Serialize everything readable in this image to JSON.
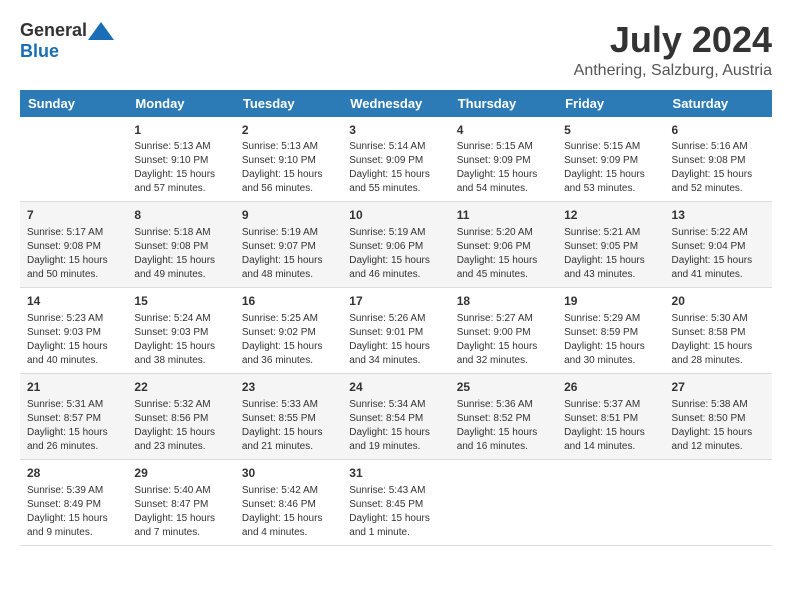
{
  "header": {
    "logo_general": "General",
    "logo_blue": "Blue",
    "title": "July 2024",
    "location": "Anthering, Salzburg, Austria"
  },
  "calendar": {
    "weekdays": [
      "Sunday",
      "Monday",
      "Tuesday",
      "Wednesday",
      "Thursday",
      "Friday",
      "Saturday"
    ],
    "weeks": [
      [
        {
          "day": "",
          "info": ""
        },
        {
          "day": "1",
          "info": "Sunrise: 5:13 AM\nSunset: 9:10 PM\nDaylight: 15 hours\nand 57 minutes."
        },
        {
          "day": "2",
          "info": "Sunrise: 5:13 AM\nSunset: 9:10 PM\nDaylight: 15 hours\nand 56 minutes."
        },
        {
          "day": "3",
          "info": "Sunrise: 5:14 AM\nSunset: 9:09 PM\nDaylight: 15 hours\nand 55 minutes."
        },
        {
          "day": "4",
          "info": "Sunrise: 5:15 AM\nSunset: 9:09 PM\nDaylight: 15 hours\nand 54 minutes."
        },
        {
          "day": "5",
          "info": "Sunrise: 5:15 AM\nSunset: 9:09 PM\nDaylight: 15 hours\nand 53 minutes."
        },
        {
          "day": "6",
          "info": "Sunrise: 5:16 AM\nSunset: 9:08 PM\nDaylight: 15 hours\nand 52 minutes."
        }
      ],
      [
        {
          "day": "7",
          "info": "Sunrise: 5:17 AM\nSunset: 9:08 PM\nDaylight: 15 hours\nand 50 minutes."
        },
        {
          "day": "8",
          "info": "Sunrise: 5:18 AM\nSunset: 9:08 PM\nDaylight: 15 hours\nand 49 minutes."
        },
        {
          "day": "9",
          "info": "Sunrise: 5:19 AM\nSunset: 9:07 PM\nDaylight: 15 hours\nand 48 minutes."
        },
        {
          "day": "10",
          "info": "Sunrise: 5:19 AM\nSunset: 9:06 PM\nDaylight: 15 hours\nand 46 minutes."
        },
        {
          "day": "11",
          "info": "Sunrise: 5:20 AM\nSunset: 9:06 PM\nDaylight: 15 hours\nand 45 minutes."
        },
        {
          "day": "12",
          "info": "Sunrise: 5:21 AM\nSunset: 9:05 PM\nDaylight: 15 hours\nand 43 minutes."
        },
        {
          "day": "13",
          "info": "Sunrise: 5:22 AM\nSunset: 9:04 PM\nDaylight: 15 hours\nand 41 minutes."
        }
      ],
      [
        {
          "day": "14",
          "info": "Sunrise: 5:23 AM\nSunset: 9:03 PM\nDaylight: 15 hours\nand 40 minutes."
        },
        {
          "day": "15",
          "info": "Sunrise: 5:24 AM\nSunset: 9:03 PM\nDaylight: 15 hours\nand 38 minutes."
        },
        {
          "day": "16",
          "info": "Sunrise: 5:25 AM\nSunset: 9:02 PM\nDaylight: 15 hours\nand 36 minutes."
        },
        {
          "day": "17",
          "info": "Sunrise: 5:26 AM\nSunset: 9:01 PM\nDaylight: 15 hours\nand 34 minutes."
        },
        {
          "day": "18",
          "info": "Sunrise: 5:27 AM\nSunset: 9:00 PM\nDaylight: 15 hours\nand 32 minutes."
        },
        {
          "day": "19",
          "info": "Sunrise: 5:29 AM\nSunset: 8:59 PM\nDaylight: 15 hours\nand 30 minutes."
        },
        {
          "day": "20",
          "info": "Sunrise: 5:30 AM\nSunset: 8:58 PM\nDaylight: 15 hours\nand 28 minutes."
        }
      ],
      [
        {
          "day": "21",
          "info": "Sunrise: 5:31 AM\nSunset: 8:57 PM\nDaylight: 15 hours\nand 26 minutes."
        },
        {
          "day": "22",
          "info": "Sunrise: 5:32 AM\nSunset: 8:56 PM\nDaylight: 15 hours\nand 23 minutes."
        },
        {
          "day": "23",
          "info": "Sunrise: 5:33 AM\nSunset: 8:55 PM\nDaylight: 15 hours\nand 21 minutes."
        },
        {
          "day": "24",
          "info": "Sunrise: 5:34 AM\nSunset: 8:54 PM\nDaylight: 15 hours\nand 19 minutes."
        },
        {
          "day": "25",
          "info": "Sunrise: 5:36 AM\nSunset: 8:52 PM\nDaylight: 15 hours\nand 16 minutes."
        },
        {
          "day": "26",
          "info": "Sunrise: 5:37 AM\nSunset: 8:51 PM\nDaylight: 15 hours\nand 14 minutes."
        },
        {
          "day": "27",
          "info": "Sunrise: 5:38 AM\nSunset: 8:50 PM\nDaylight: 15 hours\nand 12 minutes."
        }
      ],
      [
        {
          "day": "28",
          "info": "Sunrise: 5:39 AM\nSunset: 8:49 PM\nDaylight: 15 hours\nand 9 minutes."
        },
        {
          "day": "29",
          "info": "Sunrise: 5:40 AM\nSunset: 8:47 PM\nDaylight: 15 hours\nand 7 minutes."
        },
        {
          "day": "30",
          "info": "Sunrise: 5:42 AM\nSunset: 8:46 PM\nDaylight: 15 hours\nand 4 minutes."
        },
        {
          "day": "31",
          "info": "Sunrise: 5:43 AM\nSunset: 8:45 PM\nDaylight: 15 hours\nand 1 minute."
        },
        {
          "day": "",
          "info": ""
        },
        {
          "day": "",
          "info": ""
        },
        {
          "day": "",
          "info": ""
        }
      ]
    ]
  }
}
